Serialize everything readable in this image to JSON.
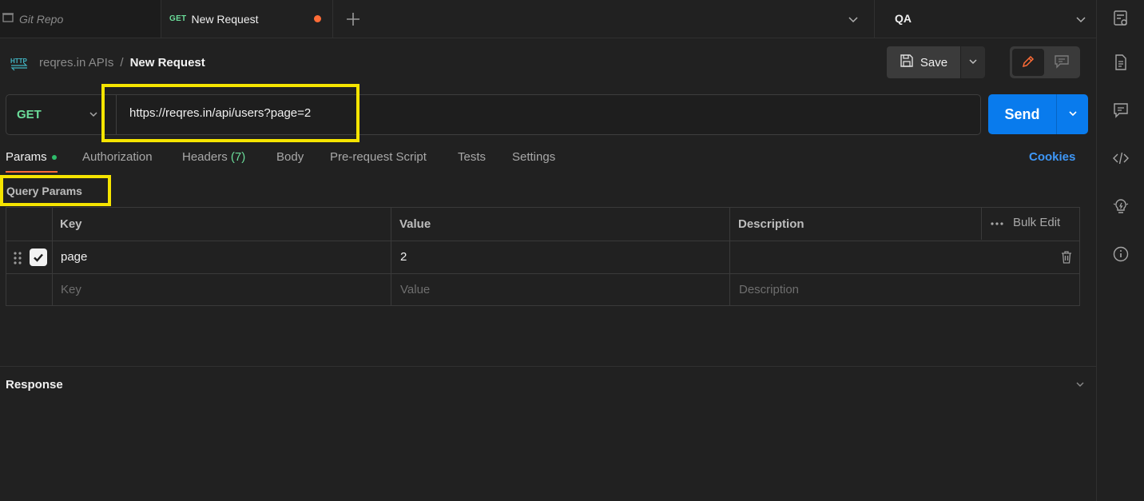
{
  "tabs": {
    "git_repo": {
      "label": "Git Repo"
    },
    "new_request": {
      "method": "GET",
      "label": "New Request"
    }
  },
  "environment": {
    "label": "QA"
  },
  "breadcrumb": {
    "collection": "reqres.in APIs",
    "separator": "/",
    "current": "New Request"
  },
  "toolbar": {
    "save_label": "Save"
  },
  "request": {
    "method": "GET",
    "url": "https://reqres.in/api/users?page=2",
    "send_label": "Send"
  },
  "subtabs": {
    "params": "Params",
    "authorization": "Authorization",
    "headers": "Headers",
    "headers_count": "(7)",
    "body": "Body",
    "prerequest": "Pre-request Script",
    "tests": "Tests",
    "settings": "Settings",
    "cookies": "Cookies"
  },
  "query_params": {
    "title": "Query Params",
    "columns": {
      "key": "Key",
      "value": "Value",
      "description": "Description"
    },
    "bulk_edit": "Bulk Edit",
    "rows": [
      {
        "key": "page",
        "value": "2",
        "description": "",
        "enabled": true
      }
    ],
    "placeholders": {
      "key": "Key",
      "value": "Value",
      "description": "Description"
    }
  },
  "response": {
    "title": "Response"
  },
  "colors": {
    "accent": "#ff6c37",
    "send": "#097bed",
    "method_get": "#6bdd9a",
    "link": "#3e97f7",
    "highlight": "#f5e400"
  },
  "icons": [
    "collection-icon",
    "add-tab-icon",
    "chevron-down-icon",
    "http-icon",
    "save-icon",
    "edit-icon",
    "comment-icon",
    "environment-quicklook-icon",
    "documentation-icon",
    "comments-icon",
    "code-icon",
    "lightbulb-icon",
    "info-icon",
    "drag-handle-icon",
    "checkbox-icon",
    "trash-icon",
    "more-icon"
  ]
}
